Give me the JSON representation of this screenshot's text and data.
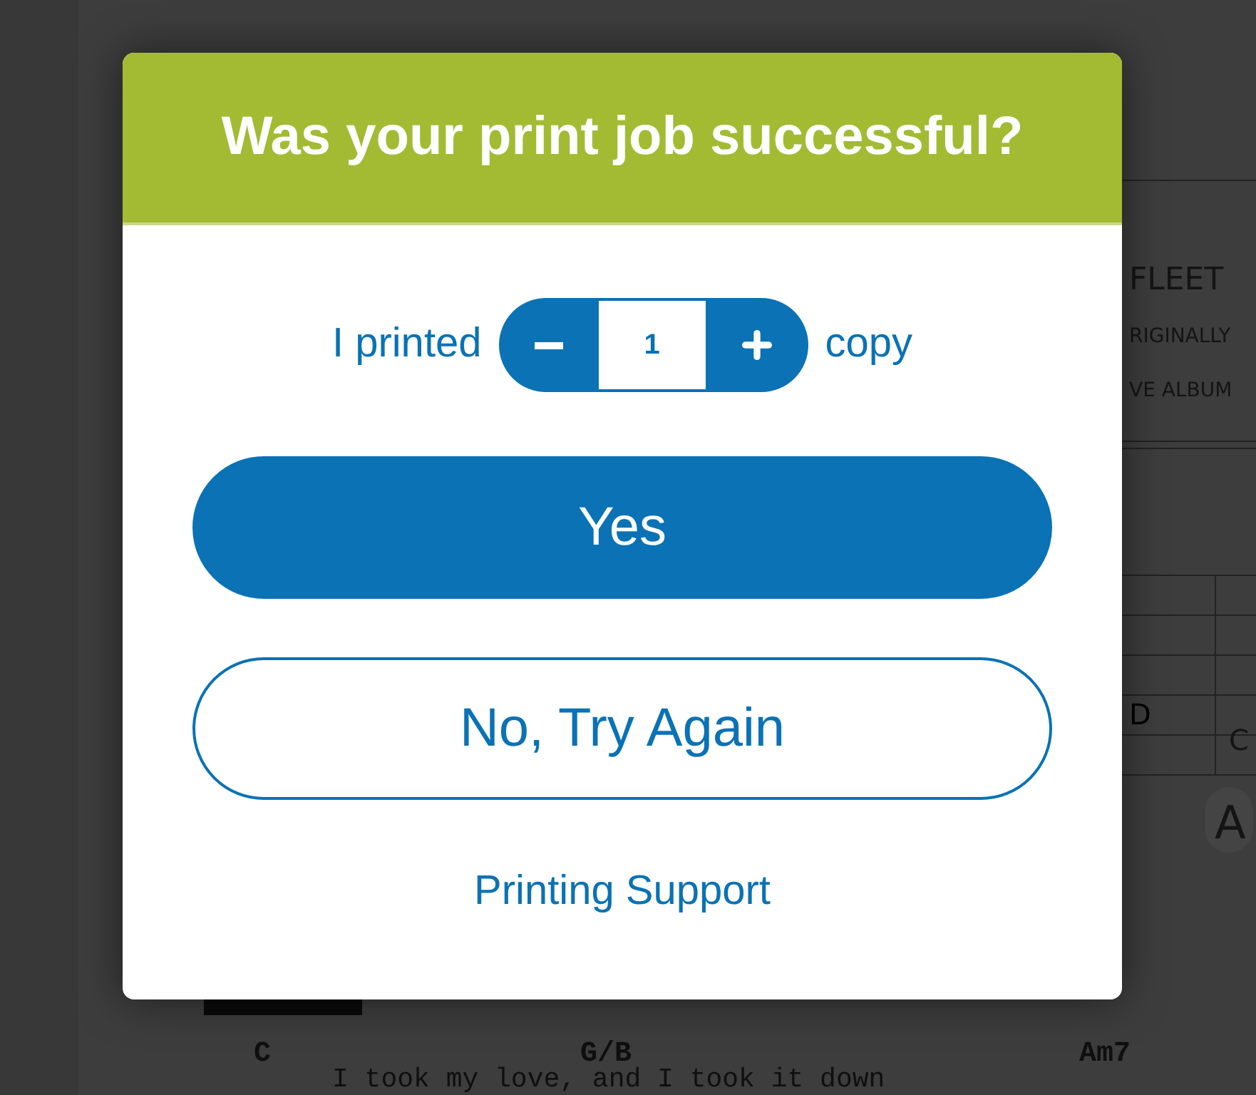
{
  "background": {
    "song_title": "FLEET",
    "subtitle_lines": [
      "RIGINALLY",
      "VE ALBUM"
    ],
    "table_letters": [
      "D",
      "C"
    ],
    "badge": "A",
    "chords": [
      "C",
      "G/B",
      "Am7"
    ],
    "lyric": "I took my love, and I took it down"
  },
  "dialog": {
    "title": "Was your print job successful?",
    "copies": {
      "prefix": "I printed",
      "value": "1",
      "suffix": "copy"
    },
    "buttons": [
      {
        "label": "Yes",
        "kind": "primary"
      },
      {
        "label": "No, Try Again",
        "kind": "outline"
      }
    ],
    "link": "Printing Support"
  }
}
